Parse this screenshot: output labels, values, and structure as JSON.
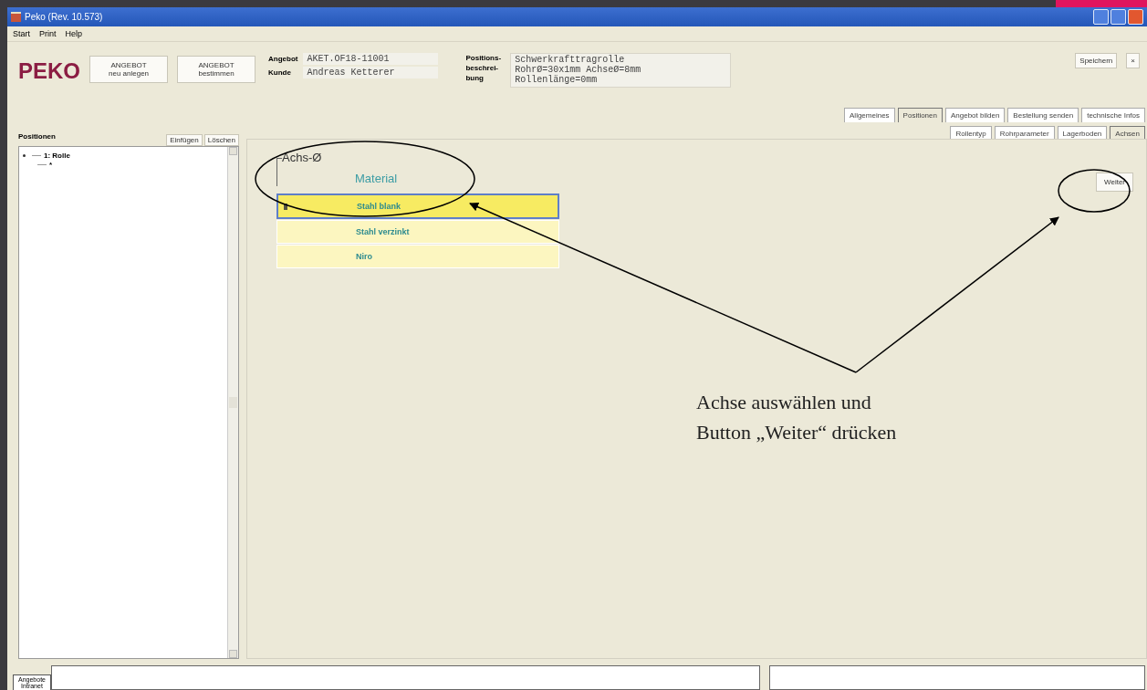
{
  "window": {
    "title": "Peko (Rev. 10.573)"
  },
  "menu": [
    "Start",
    "Print",
    "Help"
  ],
  "header": {
    "logo": "PEKO",
    "buttons": [
      {
        "lines": [
          "ANGEBOT",
          "neu anlegen"
        ]
      },
      {
        "lines": [
          "ANGEBOT",
          "bestimmen"
        ]
      }
    ],
    "fields": [
      {
        "label": "Angebot",
        "value": "AKET.OF18-11001"
      },
      {
        "label": "Kunde",
        "value": "Andreas Ketterer"
      }
    ],
    "description": {
      "label_lines": [
        "Positions-",
        "beschrei-",
        "bung"
      ],
      "value_lines": [
        "Schwerkrafttragrolle",
        "RohrØ=30x1mm AchseØ=8mm",
        "Rollenlänge=0mm"
      ]
    },
    "save_button": "Speichern",
    "close_button": "×"
  },
  "tabs": [
    {
      "label": "Allgemeines",
      "selected": false
    },
    {
      "label": "Positionen",
      "selected": true
    },
    {
      "label": "Angebot bilden",
      "selected": false
    },
    {
      "label": "Bestellung senden",
      "selected": false
    },
    {
      "label": "technische Infos",
      "selected": false
    }
  ],
  "subtabs": [
    {
      "label": "Rollentyp",
      "selected": false
    },
    {
      "label": "Rohrparameter",
      "selected": false
    },
    {
      "label": "Lagerboden",
      "selected": false
    },
    {
      "label": "Achsen",
      "selected": true
    }
  ],
  "positions": {
    "title": "Positionen",
    "buttons": [
      "Einfügen",
      "Löschen"
    ],
    "tree": [
      {
        "label": "1: Rolle",
        "children": [
          {
            "label": "*"
          }
        ]
      }
    ]
  },
  "main": {
    "group_label": "Achs-Ø",
    "column": "Material",
    "rows": [
      {
        "label": "Stahl blank",
        "selected": true
      },
      {
        "label": "Stahl verzinkt",
        "selected": false
      },
      {
        "label": "Niro",
        "selected": false
      }
    ],
    "next_button": "Weiter"
  },
  "bottom_tab": {
    "lines": [
      "Angebote",
      "Intranet"
    ]
  },
  "annotation": {
    "lines": [
      "Achse auswählen und",
      "Button „Weiter“ drücken"
    ]
  }
}
